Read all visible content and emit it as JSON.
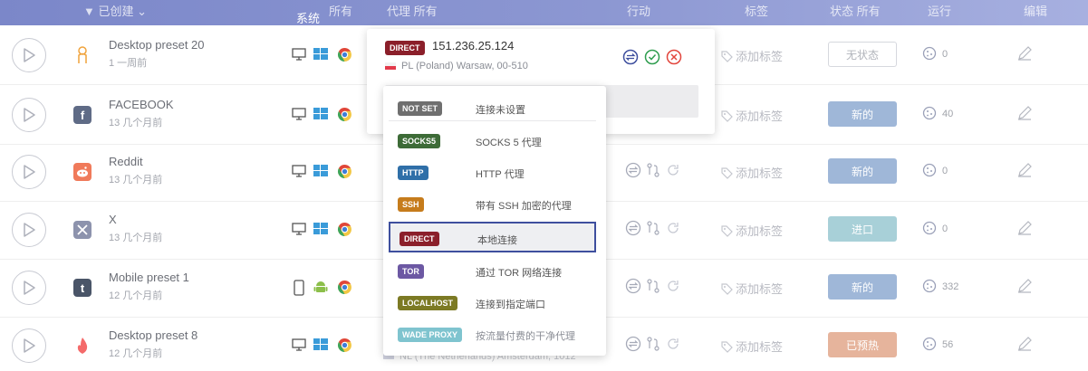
{
  "header": {
    "col_profile": "▼ 已创建 ⌄",
    "col_system": "系统",
    "col_system_sort": "所有",
    "col_proxy": "代理 所有",
    "col_actions": "行动",
    "col_tags": "标签",
    "col_status": "状态 所有",
    "col_cookies": "运行",
    "col_edit": "编辑"
  },
  "profiles": [
    {
      "name": "Desktop preset 20",
      "date": "1 一周前",
      "icon": "ghost-icon",
      "icon_color": "#f0a33c",
      "os": "desktop",
      "status": "无状态",
      "status_color": "#ffffff",
      "cookies": "0"
    },
    {
      "name": "FACEBOOK",
      "date": "13 几个月前",
      "icon": "facebook-icon",
      "icon_color": "#5f6b86",
      "os": "desktop",
      "status": "新的",
      "status_color": "#9fb7d8",
      "cookies": "40"
    },
    {
      "name": "Reddit",
      "date": "13 几个月前",
      "icon": "reddit-icon",
      "icon_color": "#f07a5a",
      "os": "desktop",
      "status": "新的",
      "status_color": "#9fb7d8",
      "cookies": "0"
    },
    {
      "name": "X",
      "date": "13 几个月前",
      "icon": "x-icon",
      "icon_color": "#8d93ad",
      "os": "desktop",
      "status": "进口",
      "status_color": "#a8d0d8",
      "cookies": "0"
    },
    {
      "name": "Mobile preset 1",
      "date": "12 几个月前",
      "icon": "tumblr-icon",
      "icon_color": "#4a5568",
      "os": "mobile",
      "status": "新的",
      "status_color": "#9fb7d8",
      "cookies": "332"
    },
    {
      "name": "Desktop preset 8",
      "date": "12 几个月前",
      "icon": "tinder-icon",
      "icon_color": "#f46a6a",
      "os": "desktop",
      "status": "已预热",
      "status_color": "#e6b49c",
      "cookies": "56"
    }
  ],
  "tag_label": "添加标签",
  "panel": {
    "badge": "DIRECT",
    "badge_color": "#8b1f2a",
    "ip": "151.236.25.124",
    "location": "PL (Poland) Warsaw, 00-510"
  },
  "dropdown": [
    {
      "badge": "NOT SET",
      "color": "#6f6f6f",
      "label": "连接未设置"
    },
    {
      "badge": "SOCKS5",
      "color": "#3d6b37",
      "label": "SOCKS 5 代理"
    },
    {
      "badge": "HTTP",
      "color": "#2f6fa8",
      "label": "HTTP 代理"
    },
    {
      "badge": "SSH",
      "color": "#c67c1c",
      "label": "带有 SSH 加密的代理"
    },
    {
      "badge": "DIRECT",
      "color": "#8b1f2a",
      "label": "本地连接",
      "selected": true
    },
    {
      "badge": "TOR",
      "color": "#6c58a3",
      "label": "通过 TOR 网络连接"
    },
    {
      "badge": "LOCALHOST",
      "color": "#7c7a24",
      "label": "连接到指定端口"
    },
    {
      "badge": "WADE PROXY",
      "color": "#7fc4cf",
      "label": "按流量付费的干净代理"
    }
  ],
  "faded_location": "NL (The Netherlands) Amsterdam, 1012"
}
